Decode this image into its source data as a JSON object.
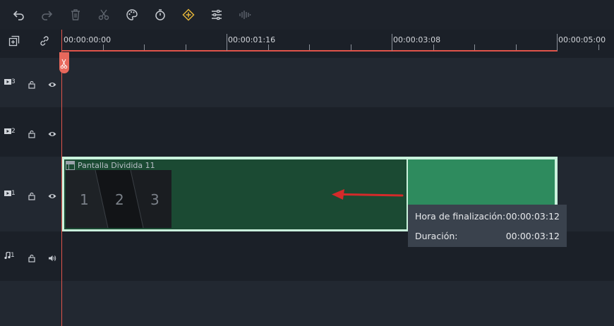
{
  "toolbar": {
    "icons": [
      "undo-icon",
      "redo-icon",
      "delete-icon",
      "cut-icon",
      "color-palette-icon",
      "speed-timer-icon",
      "keyframe-icon",
      "adjust-icon",
      "audio-wave-icon"
    ]
  },
  "ruler": {
    "labels": [
      "00:00:00:00",
      "00:00:01:16",
      "00:00:03:08",
      "00:00:05:00"
    ]
  },
  "tracks": [
    {
      "type_label": "3",
      "kind": "video"
    },
    {
      "type_label": "2",
      "kind": "video"
    },
    {
      "type_label": "1",
      "kind": "video"
    },
    {
      "type_label": "1",
      "kind": "audio"
    }
  ],
  "clip": {
    "title": "Pantalla Dividida 11",
    "thumb_numbers": [
      "1",
      "2",
      "3"
    ]
  },
  "tooltip": {
    "end_label": "Hora de finalización:",
    "end_value": "00:00:03:12",
    "duration_label": "Duración:",
    "duration_value": "00:00:03:12"
  },
  "colors": {
    "playhead": "#e0544a",
    "clip_dark": "#1b4a33",
    "clip_extend": "#2e8b5e",
    "arrow": "#d42a2a"
  }
}
